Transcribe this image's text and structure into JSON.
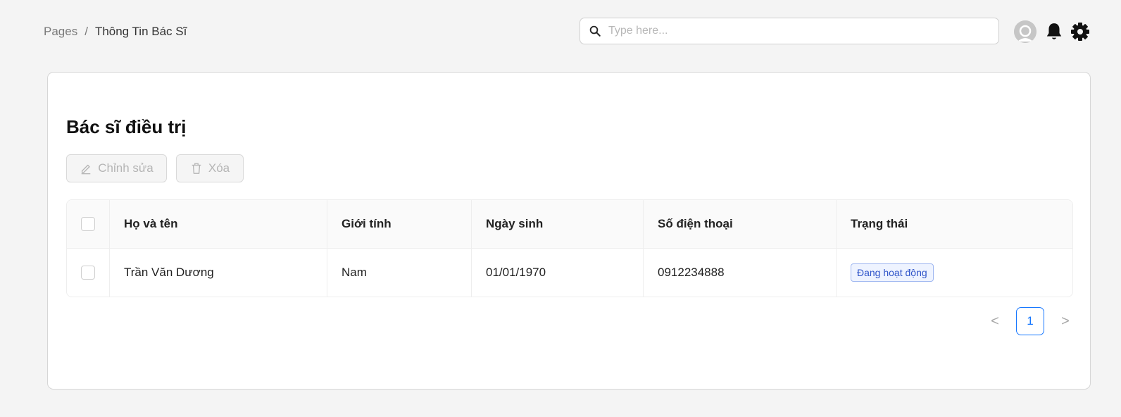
{
  "breadcrumb": {
    "root": "Pages",
    "separator": "/",
    "current": "Thông Tin Bác Sĩ"
  },
  "search": {
    "placeholder": "Type here...",
    "value": ""
  },
  "card": {
    "title": "Bác sĩ điều trị",
    "edit_label": "Chỉnh sửa",
    "delete_label": "Xóa"
  },
  "table": {
    "columns": [
      "Họ và tên",
      "Giới tính",
      "Ngày sinh",
      "Số điện thoại",
      "Trạng thái"
    ],
    "rows": [
      {
        "name": "Trần Văn Dương",
        "gender": "Nam",
        "dob": "01/01/1970",
        "phone": "0912234888",
        "status": "Đang hoạt động"
      }
    ]
  },
  "pagination": {
    "current_page": "1",
    "prev": "<",
    "next": ">"
  },
  "colors": {
    "accent": "#1677ff",
    "badge_text": "#2f54c9",
    "badge_bg": "#eef3ff"
  },
  "icons": [
    "search-icon",
    "avatar-icon",
    "bell-icon",
    "gear-icon",
    "pencil-icon",
    "trash-icon",
    "chevron-left-icon",
    "chevron-right-icon"
  ]
}
